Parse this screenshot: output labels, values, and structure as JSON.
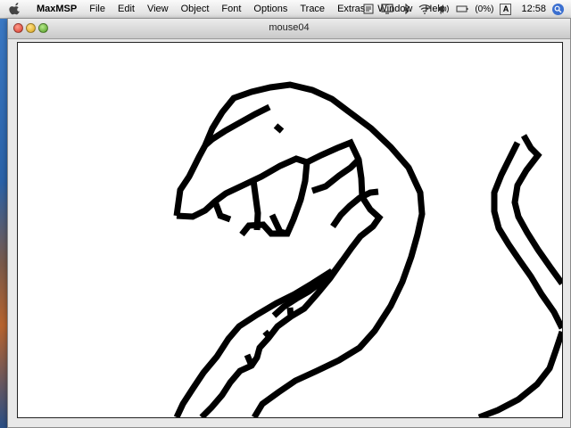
{
  "menubar": {
    "app_name": "MaxMSP",
    "items": [
      "File",
      "Edit",
      "View",
      "Object",
      "Font",
      "Options",
      "Trace",
      "Extras",
      "Window",
      "Help"
    ],
    "battery_text": "(0%)",
    "keyboard_text": "A",
    "clock": "12:58"
  },
  "window": {
    "title": "mouse04"
  },
  "icons": {
    "apple": "apple-icon",
    "status": [
      "script-icon",
      "display-icon",
      "bluetooth-icon",
      "wifi-icon",
      "volume-icon",
      "battery-icon",
      "input-menu-icon",
      "spotlight-icon"
    ]
  },
  "colors": {
    "menubar": "#e6e6e6",
    "canvas_bg": "#ffffff",
    "ink": "#000000",
    "desktop": "#2a5f9e"
  }
}
